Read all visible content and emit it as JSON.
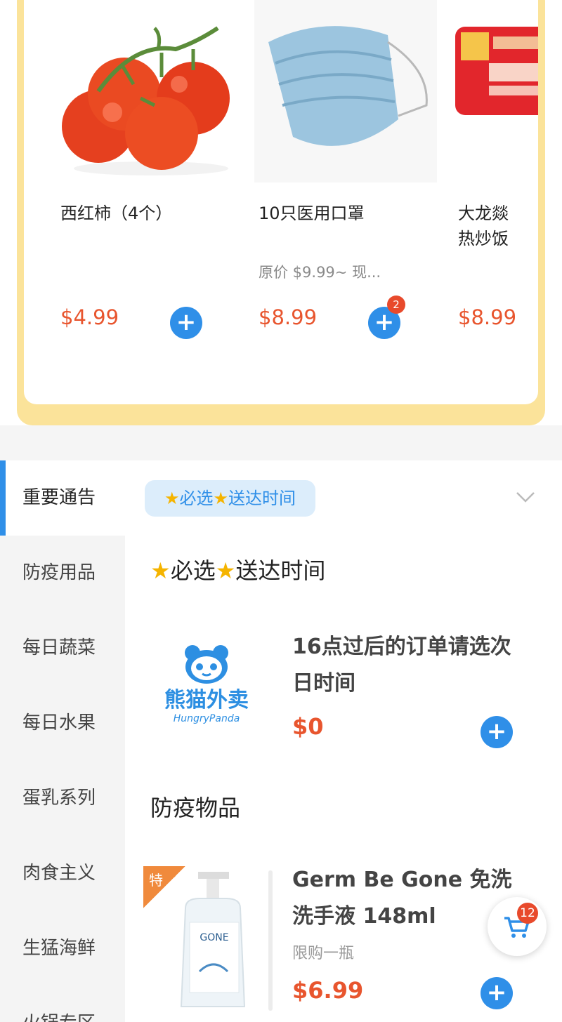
{
  "featured": [
    {
      "name": "西红柿（4个）",
      "original_price": "",
      "price": "$4.99",
      "badge": ""
    },
    {
      "name": "10只医用口罩",
      "original_price": "原价 $9.99~  现...",
      "price": "$8.99",
      "badge": "2"
    },
    {
      "name": "大龙燚\n热炒饭",
      "original_price": "",
      "price": "$8.99",
      "badge": ""
    }
  ],
  "sidebar": {
    "items": [
      {
        "label": "重要通告"
      },
      {
        "label": "防疫用品"
      },
      {
        "label": "每日蔬菜"
      },
      {
        "label": "每日水果"
      },
      {
        "label": "蛋乳系列"
      },
      {
        "label": "肉食主义"
      },
      {
        "label": "生猛海鲜"
      },
      {
        "label": "火锅专区"
      }
    ]
  },
  "main": {
    "chip_label_1": "必选",
    "chip_label_2": "送达时间",
    "section1_a": "必选",
    "section1_b": "送达时间",
    "notice": {
      "name": "16点过后的订单请选次日时间",
      "price": "$0",
      "logo_text": "熊猫外卖",
      "logo_subtext": "HungryPanda"
    },
    "section2_title": "防疫物品",
    "product": {
      "tag": "特",
      "name": "Germ Be Gone 免洗洗手液 148ml",
      "note": "限购一瓶",
      "price": "$6.99"
    }
  },
  "cart": {
    "count": "12"
  },
  "colors": {
    "accent": "#2f8fe8",
    "price": "#e8552e",
    "frame": "#fbe39a"
  }
}
